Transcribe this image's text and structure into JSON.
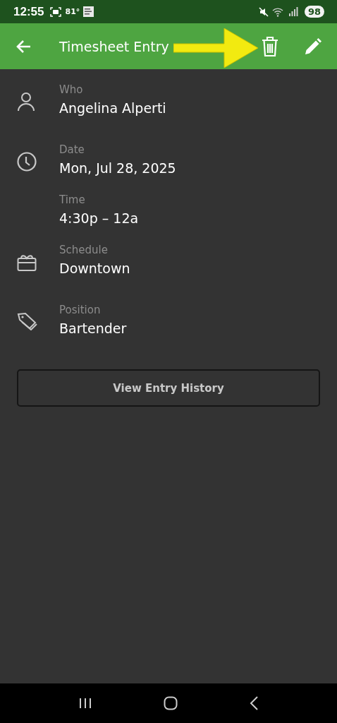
{
  "status_bar": {
    "time": "12:55",
    "temperature": "81°",
    "battery": "98"
  },
  "app_bar": {
    "title": "Timesheet Entry"
  },
  "fields": [
    {
      "kind": "person",
      "label": "Who",
      "value": "Angelina Alperti"
    },
    {
      "kind": "clock",
      "label": "Date",
      "value": "Mon, Jul 28, 2025"
    },
    {
      "kind": "none",
      "label": "Time",
      "value": "4:30p – 12a"
    },
    {
      "kind": "schedule",
      "label": "Schedule",
      "value": "Downtown"
    },
    {
      "kind": "tag",
      "label": "Position",
      "value": "Bartender"
    }
  ],
  "history_button": "View Entry History"
}
